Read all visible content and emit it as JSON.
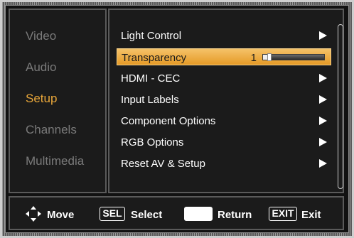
{
  "sidebar": {
    "items": [
      {
        "label": "Video",
        "active": false
      },
      {
        "label": "Audio",
        "active": false
      },
      {
        "label": "Setup",
        "active": true
      },
      {
        "label": "Channels",
        "active": false
      },
      {
        "label": "Multimedia",
        "active": false
      }
    ]
  },
  "menu": {
    "items": [
      {
        "label": "Light Control",
        "icon": "play-arrow-icon"
      },
      {
        "label": "Transparency",
        "selected": true,
        "value": "1",
        "slider_level": 0.1
      },
      {
        "label": "HDMI - CEC",
        "icon": "play-arrow-icon"
      },
      {
        "label": "Input Labels",
        "icon": "play-arrow-icon"
      },
      {
        "label": "Component Options",
        "icon": "play-arrow-icon"
      },
      {
        "label": "RGB Options",
        "icon": "play-arrow-icon"
      },
      {
        "label": "Reset AV & Setup",
        "icon": "play-arrow-icon"
      }
    ]
  },
  "footer": {
    "move_label": "Move",
    "sel_key": "SEL",
    "select_label": "Select",
    "return_label": "Return",
    "exit_key": "EXIT",
    "exit_label": "Exit"
  },
  "colors": {
    "accent": "#e9a73a",
    "inactive_text": "#7a7a7a",
    "highlight_bar": "#f0b24a"
  }
}
